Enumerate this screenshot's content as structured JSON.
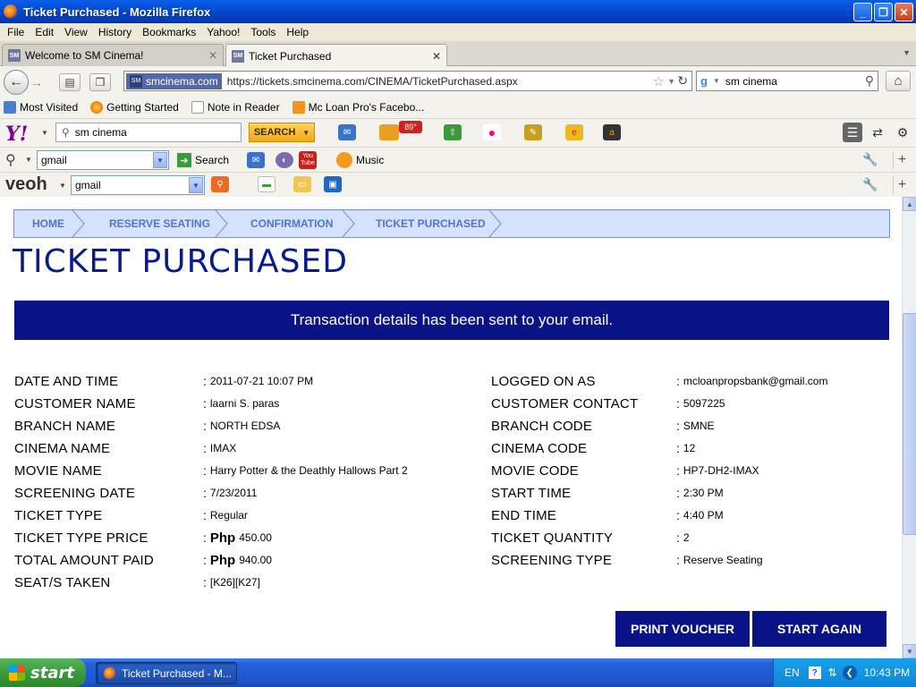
{
  "window": {
    "title": "Ticket Purchased - Mozilla Firefox",
    "min_label": "_",
    "max_label": "❐",
    "close_label": "✕"
  },
  "menu": [
    "File",
    "Edit",
    "View",
    "History",
    "Bookmarks",
    "Yahoo!",
    "Tools",
    "Help"
  ],
  "tabs": [
    {
      "label": "Welcome to SM Cinema!",
      "favicon": "SM"
    },
    {
      "label": "Ticket Purchased",
      "favicon": "SM"
    }
  ],
  "navigation": {
    "site_badge": "smcinema.com",
    "url": "https://tickets.smcinema.com/CINEMA/TicketPurchased.aspx",
    "search_value": "sm cinema"
  },
  "bookmarks": [
    "Most Visited",
    "Getting Started",
    "Note in Reader",
    "Mc Loan Pro's Facebo..."
  ],
  "yahoo_toolbar": {
    "search_value": "sm cinema",
    "search_button": "SEARCH",
    "weather": "89°"
  },
  "toolbar2": {
    "combo_value": "gmail",
    "search_label": "Search",
    "music_label": "Music",
    "youtube_label": "You Tube"
  },
  "toolbar3": {
    "logo": "veoh",
    "combo_value": "gmail"
  },
  "breadcrumb": [
    "HOME",
    "RESERVE SEATING",
    "CONFIRMATION",
    "TICKET PURCHASED"
  ],
  "page_title": "TICKET PURCHASED",
  "banner": "Transaction details has been sent to your email.",
  "details_left": [
    {
      "label": "DATE AND TIME",
      "value": "2011-07-21 10:07 PM",
      "currency": ""
    },
    {
      "label": "CUSTOMER NAME",
      "value": "laarni S. paras",
      "currency": ""
    },
    {
      "label": "BRANCH NAME",
      "value": "NORTH EDSA",
      "currency": ""
    },
    {
      "label": "CINEMA NAME",
      "value": "IMAX",
      "currency": ""
    },
    {
      "label": "MOVIE NAME",
      "value": "Harry Potter & the Deathly Hallows Part 2",
      "currency": ""
    },
    {
      "label": "SCREENING DATE",
      "value": "7/23/2011",
      "currency": ""
    },
    {
      "label": "TICKET TYPE",
      "value": "Regular",
      "currency": ""
    },
    {
      "label": "TICKET TYPE PRICE",
      "value": "450.00",
      "currency": "Php"
    },
    {
      "label": "TOTAL AMOUNT PAID",
      "value": "940.00",
      "currency": "Php"
    },
    {
      "label": "SEAT/S TAKEN",
      "value": "[K26][K27]",
      "currency": ""
    }
  ],
  "details_right": [
    {
      "label": "LOGGED ON AS",
      "value": "mcloanpropsbank@gmail.com"
    },
    {
      "label": "CUSTOMER CONTACT",
      "value": "5097225"
    },
    {
      "label": "BRANCH CODE",
      "value": "SMNE"
    },
    {
      "label": "CINEMA CODE",
      "value": "12"
    },
    {
      "label": "MOVIE CODE",
      "value": "HP7-DH2-IMAX"
    },
    {
      "label": "START TIME",
      "value": "2:30 PM"
    },
    {
      "label": "END TIME",
      "value": "4:40 PM"
    },
    {
      "label": "TICKET QUANTITY",
      "value": "2"
    },
    {
      "label": "SCREENING TYPE",
      "value": "Reserve Seating"
    }
  ],
  "buttons": {
    "print": "PRINT VOUCHER",
    "restart": "START AGAIN"
  },
  "taskbar": {
    "start": "start",
    "task": "Ticket Purchased - M...",
    "lang": "EN",
    "time": "10:43 PM"
  },
  "colors": {
    "title_blue": "#0a1c8a",
    "banner_bg": "#0a1385",
    "crumb_bg": "#d6e1fd",
    "crumb_text": "#4b78c9"
  }
}
